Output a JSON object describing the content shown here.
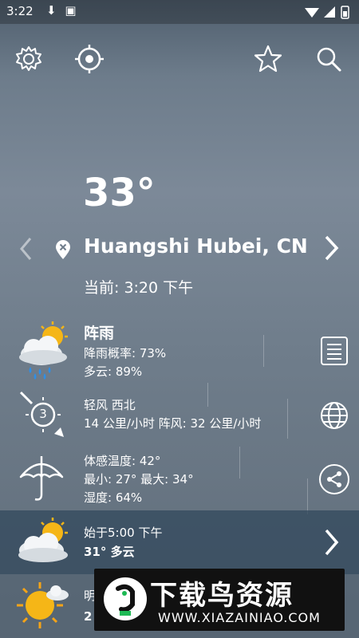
{
  "status": {
    "time": "3:22"
  },
  "weather": {
    "temperature": "33°",
    "location": "Huangshi Hubei, CN",
    "current_time": "当前: 3:20 下午",
    "condition": "阵雨",
    "precip_prob": "降雨概率: 73%",
    "cloud": "多云: 89%",
    "wind_dir": "轻风 西北",
    "wind_speed": "14 公里/小时 阵风: 32 公里/小时",
    "wind_level": "3",
    "feels_like": "体感温度: 42°",
    "minmax": "最小: 27° 最大: 34°",
    "humidity": "湿度: 64%"
  },
  "hourly": {
    "start": "始于5:00 下午",
    "summary": "31° 多云"
  },
  "daily": {
    "day": "明",
    "temp": "2"
  },
  "ad": {
    "title": "下载鸟资源",
    "url": "WWW.XIAZAINIAO.COM"
  }
}
